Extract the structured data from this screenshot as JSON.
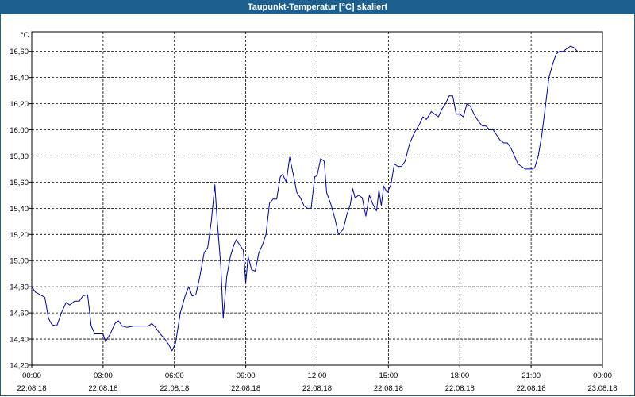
{
  "window": {
    "title": "Taupunkt-Temperatur [°C] skaliert"
  },
  "chart_data": {
    "type": "line",
    "title": "Taupunkt-Temperatur [°C] skaliert",
    "ylabel": "°C",
    "xlabel": "",
    "ylim": [
      14.2,
      16.75
    ],
    "xlim": [
      0,
      24
    ],
    "grid": true,
    "line_color": "#0000aa",
    "y_ticks": [
      "16,60",
      "16,40",
      "16,20",
      "16,00",
      "15,80",
      "15,60",
      "15,40",
      "15,20",
      "15,00",
      "14,80",
      "14,60",
      "14,40",
      "14,20"
    ],
    "x_ticks": [
      {
        "time": "00:00",
        "date": "22.08.18"
      },
      {
        "time": "03:00",
        "date": "22.08.18"
      },
      {
        "time": "06:00",
        "date": "22.08.18"
      },
      {
        "time": "09:00",
        "date": "22.08.18"
      },
      {
        "time": "12:00",
        "date": "22.08.18"
      },
      {
        "time": "15:00",
        "date": "22.08.18"
      },
      {
        "time": "18:00",
        "date": "22.08.18"
      },
      {
        "time": "21:00",
        "date": "22.08.18"
      },
      {
        "time": "00:00",
        "date": "23.08.18"
      }
    ],
    "series": [
      {
        "values": [
          [
            0.0,
            14.8
          ],
          [
            0.15,
            14.76
          ],
          [
            0.35,
            14.74
          ],
          [
            0.55,
            14.72
          ],
          [
            0.7,
            14.56
          ],
          [
            0.85,
            14.51
          ],
          [
            1.05,
            14.5
          ],
          [
            1.25,
            14.6
          ],
          [
            1.45,
            14.68
          ],
          [
            1.6,
            14.66
          ],
          [
            1.8,
            14.69
          ],
          [
            2.0,
            14.69
          ],
          [
            2.15,
            14.73
          ],
          [
            2.35,
            14.74
          ],
          [
            2.5,
            14.5
          ],
          [
            2.65,
            14.44
          ],
          [
            2.85,
            14.44
          ],
          [
            3.0,
            14.44
          ],
          [
            3.1,
            14.38
          ],
          [
            3.3,
            14.44
          ],
          [
            3.5,
            14.52
          ],
          [
            3.65,
            14.54
          ],
          [
            3.8,
            14.5
          ],
          [
            4.0,
            14.49
          ],
          [
            4.3,
            14.5
          ],
          [
            4.6,
            14.5
          ],
          [
            4.9,
            14.5
          ],
          [
            5.05,
            14.52
          ],
          [
            5.2,
            14.49
          ],
          [
            5.4,
            14.44
          ],
          [
            5.6,
            14.4
          ],
          [
            5.75,
            14.36
          ],
          [
            5.9,
            14.31
          ],
          [
            6.05,
            14.37
          ],
          [
            6.25,
            14.6
          ],
          [
            6.45,
            14.73
          ],
          [
            6.6,
            14.8
          ],
          [
            6.75,
            14.73
          ],
          [
            6.9,
            14.74
          ],
          [
            7.05,
            14.86
          ],
          [
            7.25,
            15.06
          ],
          [
            7.4,
            15.1
          ],
          [
            7.55,
            15.3
          ],
          [
            7.7,
            15.58
          ],
          [
            7.8,
            15.3
          ],
          [
            7.95,
            14.96
          ],
          [
            8.05,
            14.56
          ],
          [
            8.2,
            14.88
          ],
          [
            8.35,
            15.03
          ],
          [
            8.5,
            15.12
          ],
          [
            8.6,
            15.16
          ],
          [
            8.75,
            15.12
          ],
          [
            8.9,
            15.08
          ],
          [
            9.0,
            14.83
          ],
          [
            9.1,
            15.03
          ],
          [
            9.25,
            14.93
          ],
          [
            9.4,
            14.92
          ],
          [
            9.55,
            15.06
          ],
          [
            9.7,
            15.12
          ],
          [
            9.85,
            15.2
          ],
          [
            10.0,
            15.44
          ],
          [
            10.15,
            15.47
          ],
          [
            10.3,
            15.47
          ],
          [
            10.45,
            15.64
          ],
          [
            10.55,
            15.66
          ],
          [
            10.7,
            15.6
          ],
          [
            10.85,
            15.79
          ],
          [
            11.0,
            15.66
          ],
          [
            11.15,
            15.52
          ],
          [
            11.3,
            15.48
          ],
          [
            11.45,
            15.42
          ],
          [
            11.6,
            15.4
          ],
          [
            11.75,
            15.4
          ],
          [
            11.9,
            15.64
          ],
          [
            12.0,
            15.65
          ],
          [
            12.15,
            15.78
          ],
          [
            12.3,
            15.76
          ],
          [
            12.4,
            15.52
          ],
          [
            12.6,
            15.42
          ],
          [
            12.75,
            15.32
          ],
          [
            12.9,
            15.2
          ],
          [
            13.1,
            15.24
          ],
          [
            13.25,
            15.35
          ],
          [
            13.4,
            15.43
          ],
          [
            13.5,
            15.55
          ],
          [
            13.6,
            15.48
          ],
          [
            13.75,
            15.5
          ],
          [
            13.9,
            15.48
          ],
          [
            14.05,
            15.34
          ],
          [
            14.2,
            15.5
          ],
          [
            14.35,
            15.43
          ],
          [
            14.5,
            15.38
          ],
          [
            14.6,
            15.54
          ],
          [
            14.7,
            15.42
          ],
          [
            14.8,
            15.57
          ],
          [
            14.95,
            15.52
          ],
          [
            15.1,
            15.58
          ],
          [
            15.25,
            15.74
          ],
          [
            15.4,
            15.72
          ],
          [
            15.55,
            15.72
          ],
          [
            15.7,
            15.76
          ],
          [
            15.9,
            15.9
          ],
          [
            16.1,
            15.98
          ],
          [
            16.3,
            16.04
          ],
          [
            16.45,
            16.1
          ],
          [
            16.6,
            16.08
          ],
          [
            16.8,
            16.14
          ],
          [
            16.95,
            16.12
          ],
          [
            17.1,
            16.1
          ],
          [
            17.25,
            16.16
          ],
          [
            17.4,
            16.2
          ],
          [
            17.55,
            16.26
          ],
          [
            17.7,
            16.26
          ],
          [
            17.85,
            16.12
          ],
          [
            18.0,
            16.12
          ],
          [
            18.15,
            16.1
          ],
          [
            18.3,
            16.2
          ],
          [
            18.45,
            16.18
          ],
          [
            18.6,
            16.12
          ],
          [
            18.8,
            16.06
          ],
          [
            18.95,
            16.03
          ],
          [
            19.1,
            16.03
          ],
          [
            19.25,
            16.0
          ],
          [
            19.4,
            16.0
          ],
          [
            19.55,
            15.96
          ],
          [
            19.7,
            15.92
          ],
          [
            19.85,
            15.9
          ],
          [
            20.0,
            15.9
          ],
          [
            20.15,
            15.86
          ],
          [
            20.3,
            15.8
          ],
          [
            20.45,
            15.74
          ],
          [
            20.6,
            15.72
          ],
          [
            20.75,
            15.7
          ],
          [
            20.9,
            15.7
          ],
          [
            21.05,
            15.7
          ],
          [
            21.15,
            15.71
          ],
          [
            21.3,
            15.8
          ],
          [
            21.45,
            15.96
          ],
          [
            21.6,
            16.18
          ],
          [
            21.75,
            16.4
          ],
          [
            21.9,
            16.5
          ],
          [
            22.05,
            16.58
          ],
          [
            22.2,
            16.6
          ],
          [
            22.35,
            16.6
          ],
          [
            22.5,
            16.62
          ],
          [
            22.65,
            16.64
          ],
          [
            22.8,
            16.63
          ],
          [
            22.95,
            16.6
          ]
        ]
      }
    ]
  }
}
